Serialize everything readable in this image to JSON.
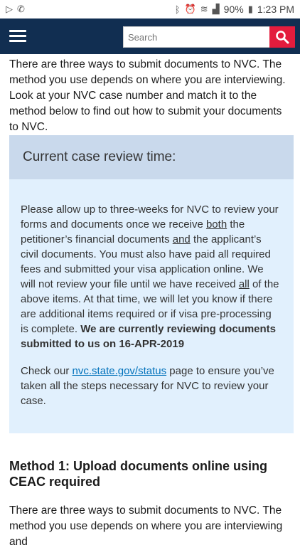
{
  "status_bar": {
    "time": "1:23 PM",
    "battery": "90%"
  },
  "header": {
    "search_placeholder": "Search"
  },
  "intro_text": "There are three ways to submit documents to NVC. The method you use depends on where you are interviewing. Look at your NVC case number and match it to the method below to find out how to submit your documents to NVC.",
  "review": {
    "title": "Current case review time:",
    "p1_a": "Please allow up to three-weeks for NVC to review your forms and documents once we receive ",
    "p1_both": "both",
    "p1_b": " the petitioner’s financial documents ",
    "p1_and": "and",
    "p1_c": " the applicant’s civil documents. You must also have paid all required fees and submitted your visa application online. We will not review your file until we have received ",
    "p1_all": "all",
    "p1_d": " of the above items. At that time, we will let you know if there are additional items required or if visa pre-processing is complete. ",
    "p1_bold": "We are currently reviewing documents submitted to us on 16-APR-2019",
    "p2_a": "Check our ",
    "p2_link": "nvc.state.gov/status",
    "p2_b": " page to ensure you’ve taken all the steps necessary for NVC to review your case."
  },
  "method1_title": "Method 1: Upload documents online using CEAC required",
  "intro_text_2": "There are three ways to submit documents to NVC. The method you use depends on where you are interviewing and"
}
